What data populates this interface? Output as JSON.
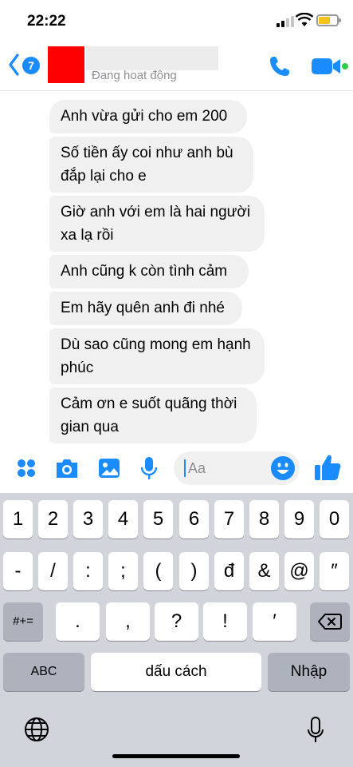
{
  "status_bar": {
    "time": "22:22"
  },
  "header": {
    "unread_count": "7",
    "contact_status": "Đang hoạt động",
    "icons": {
      "back": "chevron-left-icon",
      "call": "phone-icon",
      "video": "video-camera-icon"
    }
  },
  "messages": [
    {
      "lines": [
        "Anh vừa gửi cho em 200"
      ]
    },
    {
      "lines": [
        "Số tiền ấy coi như anh bù",
        "đắp lại cho e"
      ]
    },
    {
      "lines": [
        "Giờ anh với em là hai người",
        "xa lạ rồi"
      ]
    },
    {
      "lines": [
        "Anh cũng k còn tình cảm"
      ]
    },
    {
      "lines": [
        "Em hãy quên anh đi nhé"
      ]
    },
    {
      "lines": [
        "Dù sao cũng mong em hạnh",
        "phúc"
      ]
    },
    {
      "lines": [
        "Cảm ơn e suốt quãng thời",
        "gian qua"
      ]
    }
  ],
  "composer": {
    "placeholder": "Aa",
    "icons": [
      "apps-icon",
      "camera-icon",
      "photo-icon",
      "microphone-icon",
      "emoji-icon",
      "thumbs-up-icon"
    ]
  },
  "keyboard": {
    "row1": [
      "1",
      "2",
      "3",
      "4",
      "5",
      "6",
      "7",
      "8",
      "9",
      "0"
    ],
    "row2": [
      "-",
      "/",
      ":",
      ";",
      "(",
      ")",
      "đ",
      "&",
      "@",
      "″"
    ],
    "row3": [
      ".",
      ",",
      "?",
      "!",
      "′"
    ],
    "shift_label": "#+=",
    "abc_label": "ABC",
    "space_label": "dấu cách",
    "return_label": "Nhập"
  },
  "colors": {
    "accent": "#1a8cff",
    "bubble": "#f1f0f0",
    "keyboard_bg": "#d1d4db",
    "online": "#31cc46"
  }
}
